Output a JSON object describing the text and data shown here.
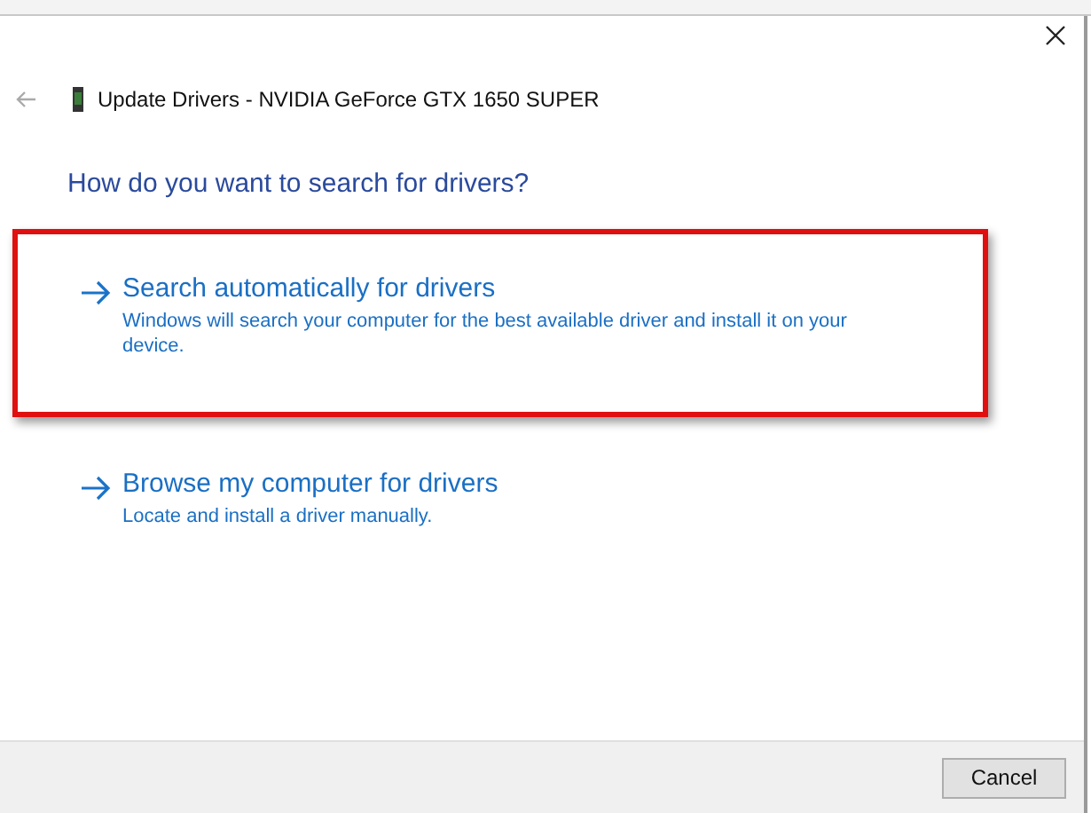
{
  "dialog": {
    "title": "Update Drivers - NVIDIA GeForce GTX 1650 SUPER",
    "heading": "How do you want to search for drivers?"
  },
  "options": [
    {
      "title": "Search automatically for drivers",
      "description": "Windows will search your computer for the best available driver and install it on your device.",
      "highlighted": true
    },
    {
      "title": "Browse my computer for drivers",
      "description": "Locate and install a driver manually.",
      "highlighted": false
    }
  ],
  "buttons": [
    "Cancel"
  ]
}
